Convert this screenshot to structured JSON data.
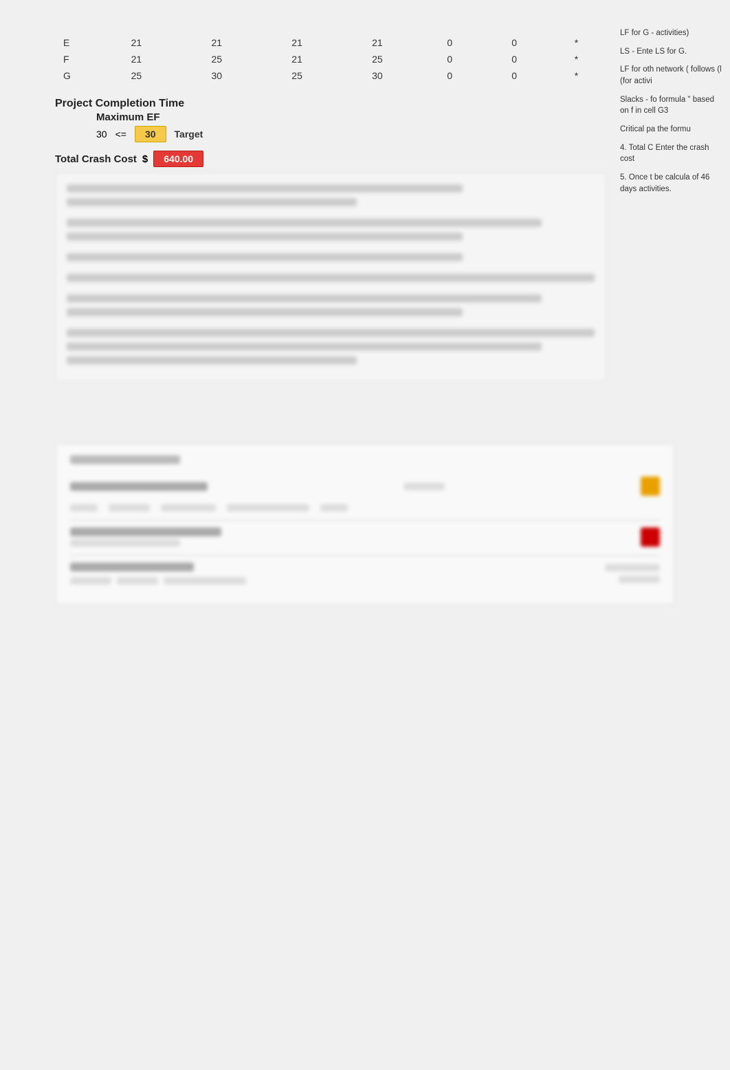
{
  "table": {
    "rows": [
      {
        "label": "E",
        "c1": "21",
        "c2": "21",
        "c3": "21",
        "c4": "21",
        "c5": "0",
        "c6": "0",
        "c7": "*"
      },
      {
        "label": "F",
        "c1": "21",
        "c2": "25",
        "c3": "21",
        "c4": "25",
        "c5": "0",
        "c6": "0",
        "c7": "*"
      },
      {
        "label": "G",
        "c1": "25",
        "c2": "30",
        "c3": "25",
        "c4": "30",
        "c5": "0",
        "c6": "0",
        "c7": "*"
      }
    ]
  },
  "project_completion": {
    "title": "Project Completion Time",
    "subtitle": "Maximum EF",
    "value": "30",
    "operator": "<=",
    "target_value": "30",
    "target_label": "Target"
  },
  "crash_cost": {
    "label": "Total Crash Cost",
    "dollar": "$",
    "value": "640.00"
  },
  "right_notes": [
    "LF for G - activities)",
    "LS - Ente LS for G.",
    "LF for oth network ( follows (l (for activi",
    "Slacks - fo formula \" based on f in cell G3",
    "Critical pa the formu",
    "4. Total C Enter the crash cost",
    "5.  Once t be calcula of 46 days activities."
  ]
}
